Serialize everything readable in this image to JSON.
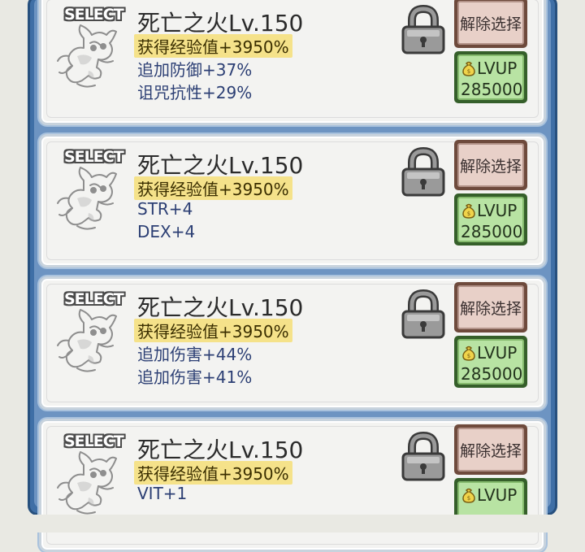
{
  "items": [
    {
      "select_label": "SELECT",
      "title": "死亡之火Lv.150",
      "stats": [
        "获得经验值+3950%",
        "追加防御+37%",
        "诅咒抗性+29%"
      ],
      "release_label": "解除选择",
      "lvup_label": "LVUP",
      "cost": "285000"
    },
    {
      "select_label": "SELECT",
      "title": "死亡之火Lv.150",
      "stats": [
        "获得经验值+3950%",
        "STR+4",
        "DEX+4"
      ],
      "release_label": "解除选择",
      "lvup_label": "LVUP",
      "cost": "285000"
    },
    {
      "select_label": "SELECT",
      "title": "死亡之火Lv.150",
      "stats": [
        "获得经验值+3950%",
        "追加伤害+44%",
        "追加伤害+41%"
      ],
      "release_label": "解除选择",
      "lvup_label": "LVUP",
      "cost": "285000"
    },
    {
      "select_label": "SELECT",
      "title": "死亡之火Lv.150",
      "stats": [
        "获得经验值+3950%",
        "VIT+1"
      ],
      "release_label": "解除选择",
      "lvup_label": "LVUP",
      "cost": ""
    }
  ],
  "colors": {
    "frame_blue": "#3f6fa6",
    "highlight_yellow": "#f5e28a",
    "release_button": "#e8d0c8",
    "lvup_button": "#b8e3a3"
  }
}
